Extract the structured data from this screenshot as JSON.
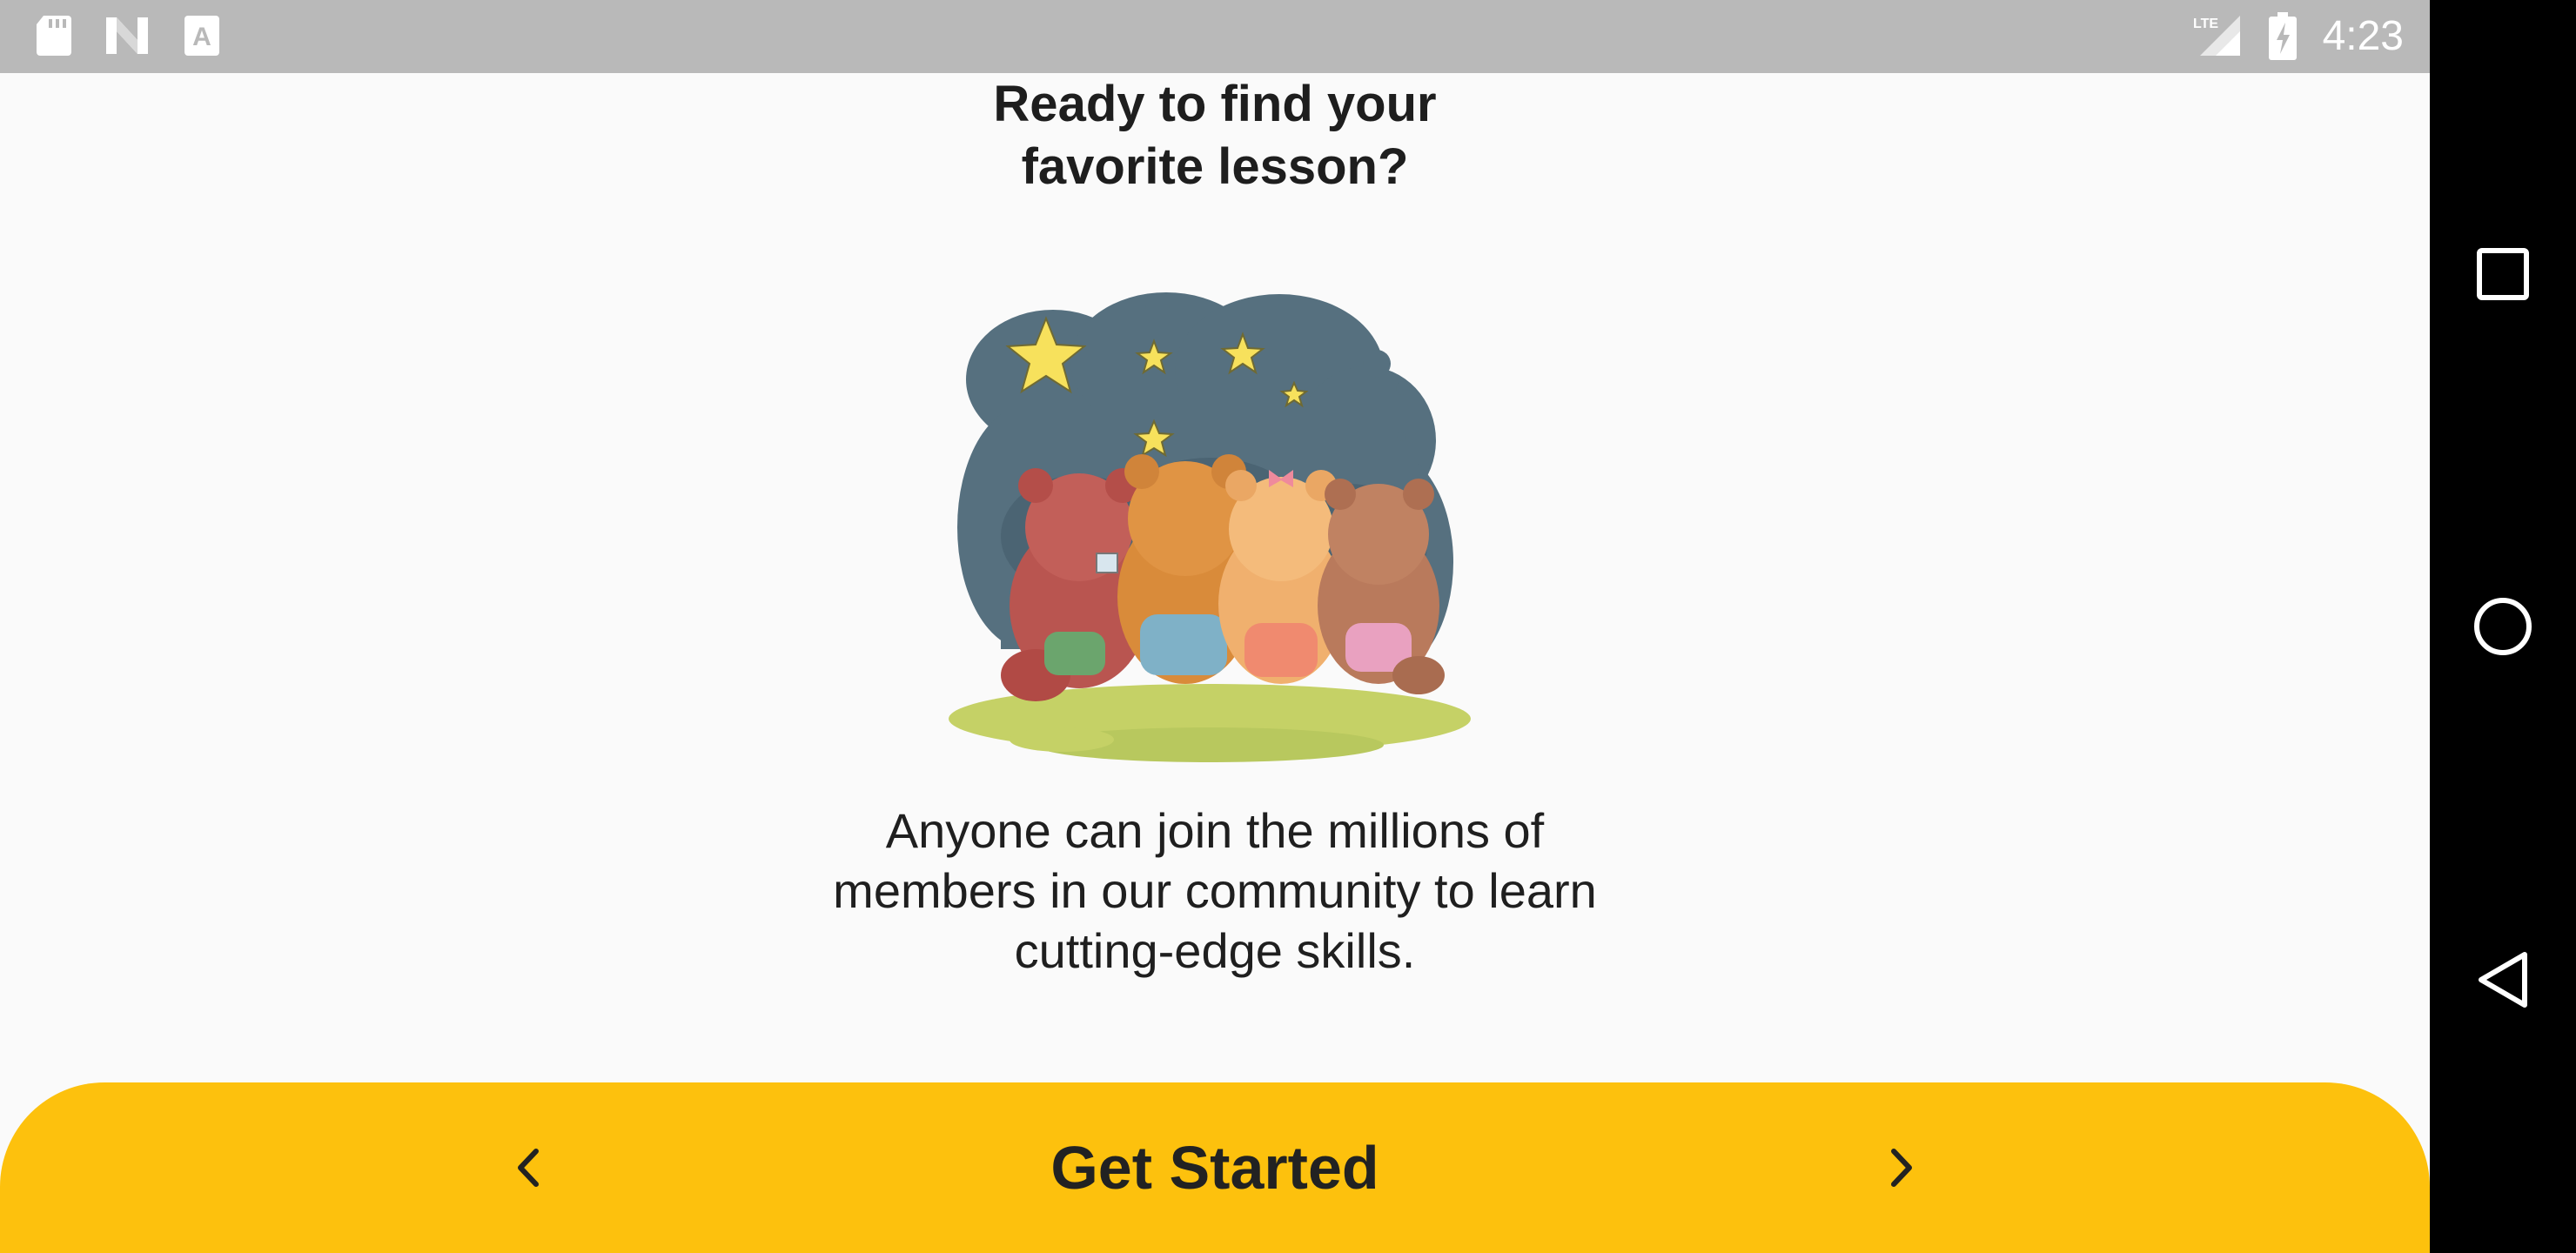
{
  "status_bar": {
    "time": "4:23",
    "left_icons": [
      "sd-card-icon",
      "n-logo-icon",
      "font-a-icon"
    ],
    "right_icons": [
      "lte-signal-icon",
      "battery-charging-icon"
    ],
    "network_label": "LTE"
  },
  "onboarding": {
    "title": "Ready to find your\nfavorite lesson?",
    "description": "Anyone can join the millions of\nmembers in our community to learn\ncutting-edge skills.",
    "illustration": "bears-watching-stars-illustration"
  },
  "bottom_bar": {
    "primary_label": "Get Started",
    "prev_icon": "chevron-left-icon",
    "next_icon": "chevron-right-icon",
    "color": "#fdc10d"
  },
  "nav_bar": {
    "buttons": [
      "recents-square-icon",
      "home-circle-icon",
      "back-triangle-icon"
    ]
  }
}
